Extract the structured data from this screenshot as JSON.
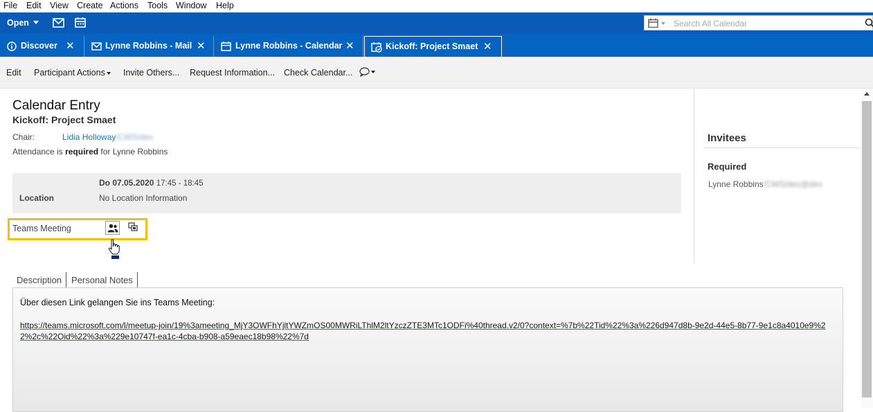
{
  "menu": [
    "File",
    "Edit",
    "View",
    "Create",
    "Actions",
    "Tools",
    "Window",
    "Help"
  ],
  "topbar": {
    "open_label": "Open",
    "search_placeholder": "Search All Calendar"
  },
  "tabs": [
    {
      "label": "Discover",
      "icon": "info-icon"
    },
    {
      "label": "Lynne Robbins - Mail",
      "icon": "mail-icon"
    },
    {
      "label": "Lynne Robbins - Calendar",
      "icon": "calendar-icon"
    },
    {
      "label": "Kickoff: Project Smaet",
      "icon": "calendar-check-icon",
      "active": true
    }
  ],
  "toolbar": {
    "edit": "Edit",
    "participant_actions": "Participant Actions",
    "invite_others": "Invite Others...",
    "request_information": "Request Information...",
    "check_calendar": "Check Calendar..."
  },
  "entry": {
    "heading": "Calendar Entry",
    "subject": "Kickoff: Project Smaet",
    "chair_label": "Chair:",
    "chair_name": "Lidia Holloway",
    "chair_suffix": "/CWS/dev",
    "attendance_prefix": "Attendance is ",
    "attendance_bold": "required",
    "attendance_suffix": " for Lynne Robbins",
    "date": "Do 07.05.2020",
    "time": "17:45 - 18:45",
    "location_label": "Location",
    "location_value": "No Location Information",
    "teams_label": "Teams Meeting"
  },
  "invitees": {
    "heading": "Invitees",
    "required_label": "Required",
    "person": "Lynne Robbins",
    "person_suffix": "/CWS/dev@dev"
  },
  "desc_tabs": [
    "Description",
    "Personal Notes"
  ],
  "description": {
    "intro": "Über diesen Link gelangen Sie ins Teams Meeting:",
    "link": "https://teams.microsoft.com/l/meetup-join/19%3ameeting_MjY3OWFhYjltYWZmOS00MWRiLThlM2ltYzczZTE3MTc1ODFi%40thread.v2/0?context=%7b%22Tid%22%3a%226d947d8b-9e2d-44e5-8b77-9e1c8a4010e9%22%2c%22Oid%22%3a%229e10747f-ea1c-4cba-b908-a59eaec18b98%22%7d"
  },
  "colors": {
    "header_blue": "#0563c1",
    "highlight": "#f2c000",
    "link_blue": "#1e73b8"
  }
}
